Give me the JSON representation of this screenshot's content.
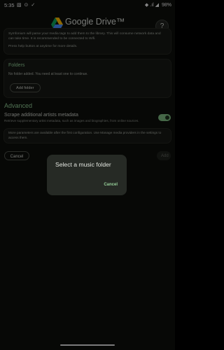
{
  "status_bar": {
    "time": "5:35",
    "notification_icons": [
      "image-icon",
      "google-drive-icon",
      "check-icon"
    ],
    "icons_text": "▧ ⊙ ✓",
    "signal_text": "◆ .ıl ◢",
    "battery": "98%"
  },
  "header": {
    "title": "Google Drive™",
    "help_label": "?"
  },
  "intro": {
    "line1": "Symfonium will parse your media tags to add them to the library. This will consume network data and can take time. It is recommended to be connected to Wifi.",
    "line2": "Press help button at anytime for more details."
  },
  "folders": {
    "title": "Folders",
    "empty_text": "No folder added. You need at least one to continue.",
    "add_button": "Add folder"
  },
  "advanced": {
    "heading": "Advanced",
    "setting_title": "Scrape additional artists metadata",
    "setting_subtitle": "Retrieve supplementary artist metadata, such as images and biographies, from online sources.",
    "toggle_on": true
  },
  "note": "More parameters are available after the first configuration. Use Manage media providers in the settings to access them.",
  "footer": {
    "cancel": "Cancel",
    "add": "Add"
  },
  "dialog": {
    "title": "Select a music folder",
    "cancel": "Cancel"
  },
  "colors": {
    "background": "#0d0e0c",
    "accent": "#8bc48f",
    "dialog_bg": "#262a25"
  }
}
